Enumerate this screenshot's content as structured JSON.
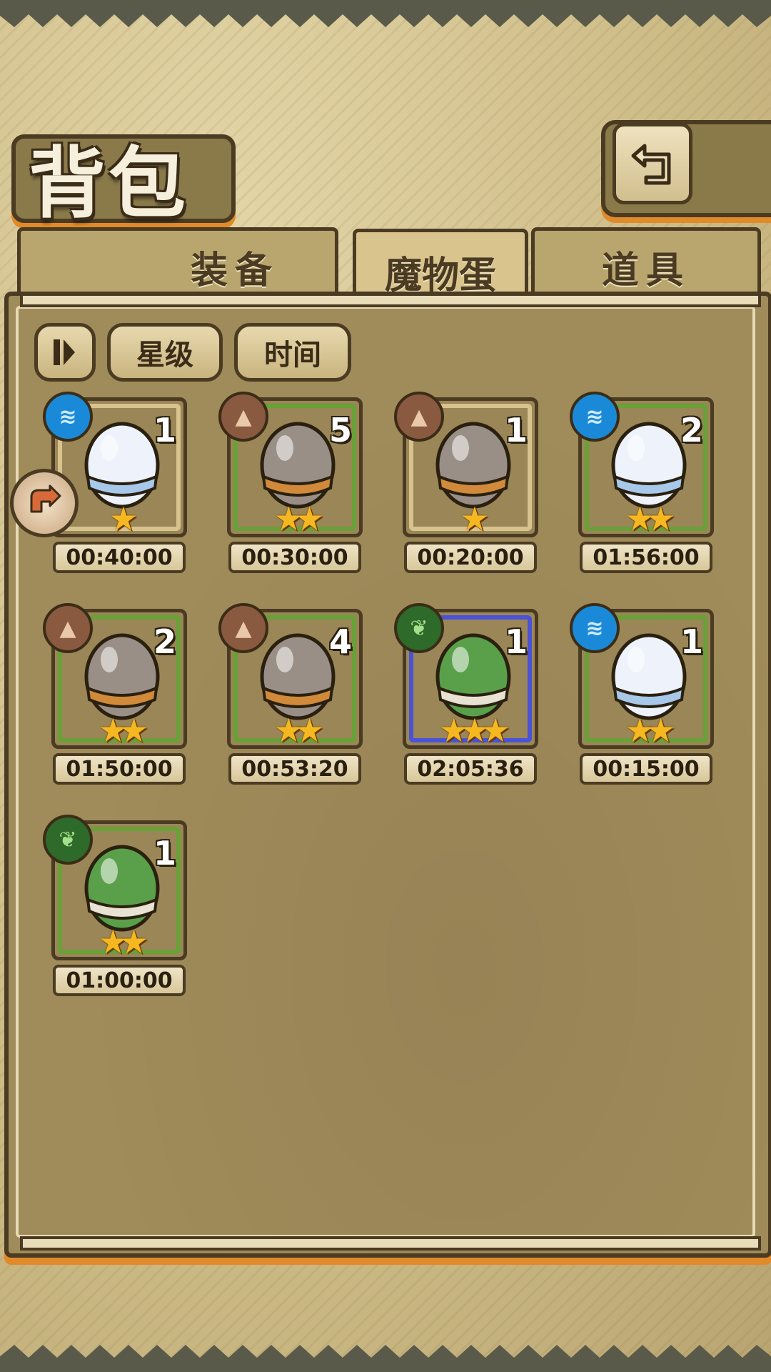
{
  "header": {
    "title": "背包"
  },
  "tabs": [
    {
      "label": "装备",
      "active": false
    },
    {
      "label": "魔物蛋",
      "active": true
    },
    {
      "label": "道具",
      "active": false
    }
  ],
  "filters": {
    "sort_icon": "sort-toggle-icon",
    "star_label": "星级",
    "time_label": "时间"
  },
  "eggs": [
    {
      "element": "water",
      "count": "1",
      "stars": 1,
      "time": "00:40:00",
      "rarity": 1
    },
    {
      "element": "earth",
      "count": "5",
      "stars": 2,
      "time": "00:30:00",
      "rarity": 2
    },
    {
      "element": "earth",
      "count": "1",
      "stars": 1,
      "time": "00:20:00",
      "rarity": 1
    },
    {
      "element": "water",
      "count": "2",
      "stars": 2,
      "time": "01:56:00",
      "rarity": 2
    },
    {
      "element": "earth",
      "count": "2",
      "stars": 2,
      "time": "01:50:00",
      "rarity": 2
    },
    {
      "element": "earth",
      "count": "4",
      "stars": 2,
      "time": "00:53:20",
      "rarity": 2
    },
    {
      "element": "wood",
      "count": "1",
      "stars": 3,
      "time": "02:05:36",
      "rarity": 3
    },
    {
      "element": "water",
      "count": "1",
      "stars": 2,
      "time": "00:15:00",
      "rarity": 2
    },
    {
      "element": "wood",
      "count": "1",
      "stars": 2,
      "time": "01:00:00",
      "rarity": 2
    }
  ],
  "colors": {
    "water": "#1a8ad8",
    "earth": "#8a5a40",
    "wood": "#2e6a2a",
    "star": "#f5b820",
    "frame_green": "#6aa038",
    "frame_blue": "#4a52d8",
    "accent_orange": "#e08a2a"
  }
}
